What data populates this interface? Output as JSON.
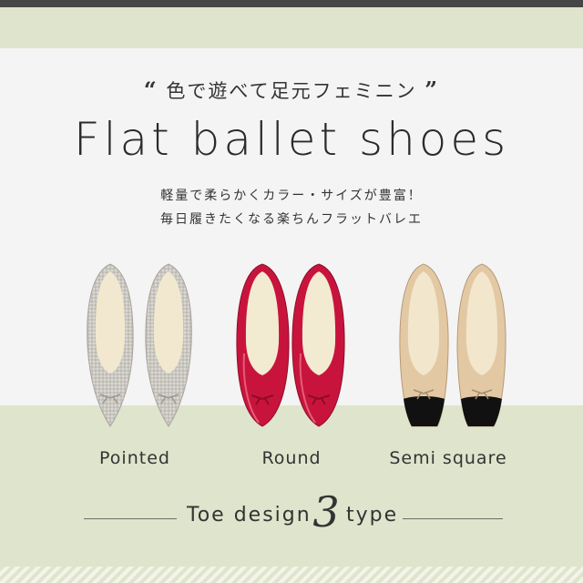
{
  "header": {
    "catchphrase": "色で遊べて足元フェミニン",
    "open_quote": "“",
    "close_quote": "”",
    "title": "Flat ballet shoes",
    "description_line1": "軽量で柔らかくカラー・サイズが豊富！",
    "description_line2": "毎日履きたくなる楽ちんフラットバレエ"
  },
  "shoes": [
    {
      "label": "Pointed",
      "color": "#c9c6c0",
      "lining": "#f1e8cf"
    },
    {
      "label": "Round",
      "color": "#c8143c",
      "lining": "#f3ead2"
    },
    {
      "label": "Semi square",
      "color": "#e3c8a4",
      "lining": "#f2e6cc",
      "toe_cap": "#111111"
    }
  ],
  "footer": {
    "toe_label": "Toe design",
    "count": "3",
    "type_label": "type"
  },
  "colors": {
    "band": "#dfe4cc",
    "panel": "#f4f4f4",
    "topbar": "#464646"
  }
}
